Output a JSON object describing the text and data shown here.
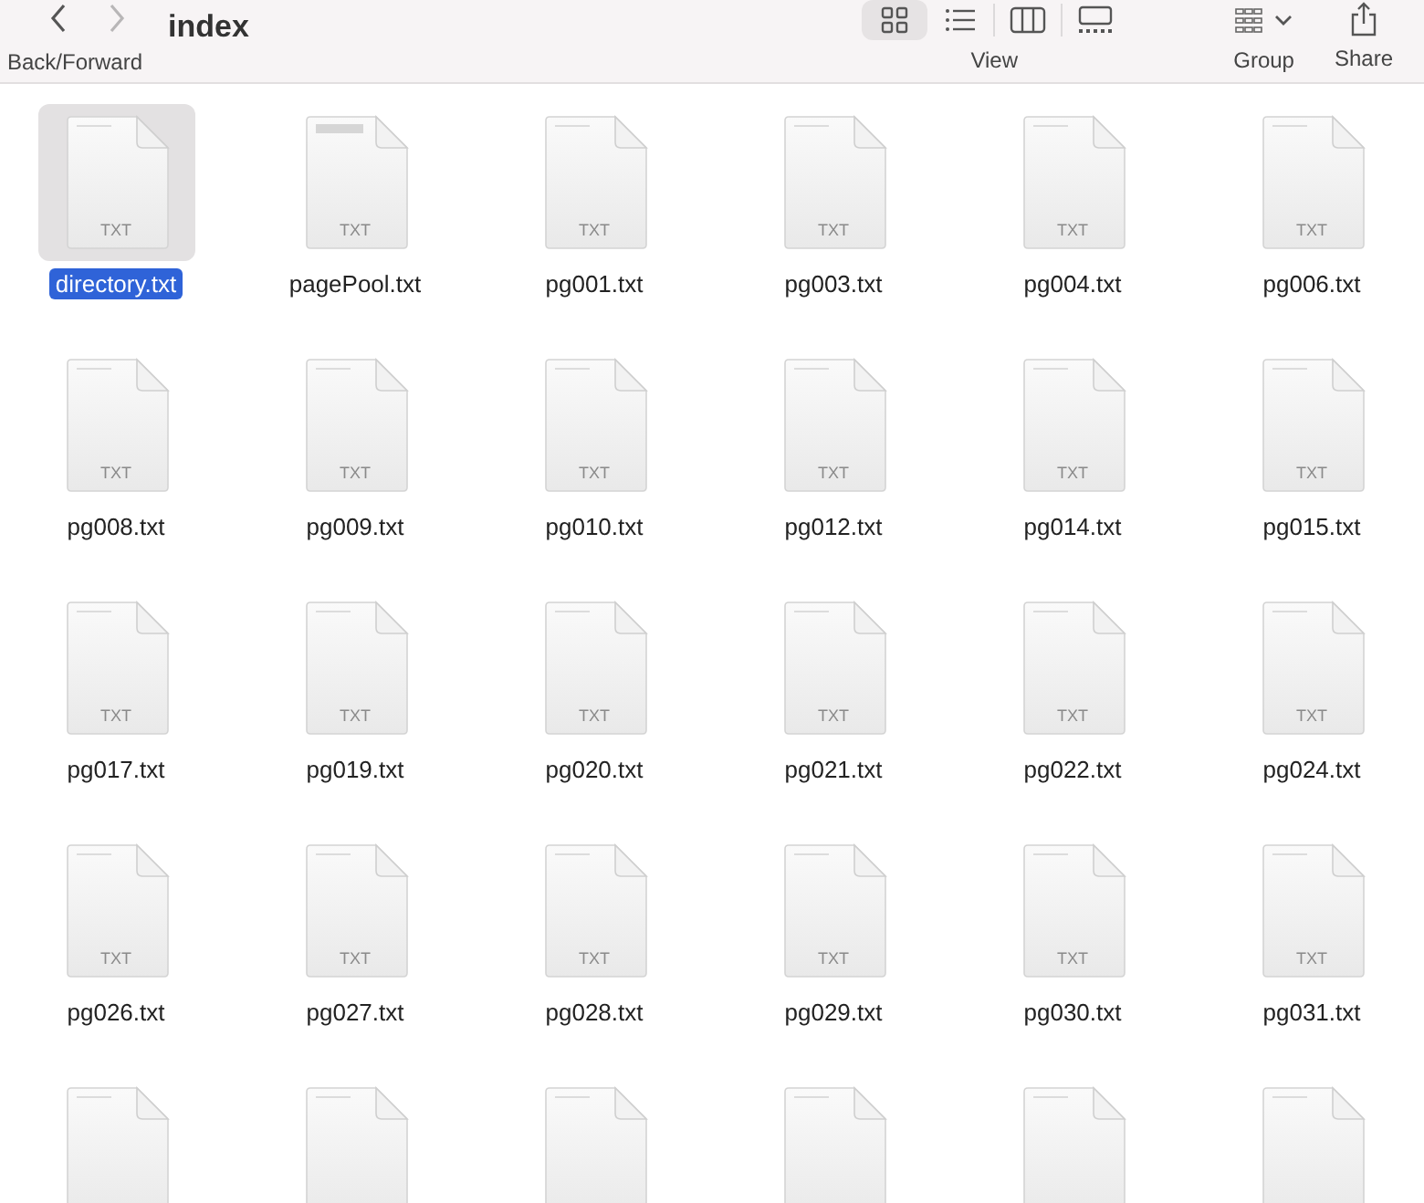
{
  "toolbar": {
    "nav_buttons": [
      {
        "kind": "back",
        "disabled": false
      },
      {
        "kind": "forward",
        "disabled": true
      }
    ],
    "nav_label": "Back/Forward",
    "title": "index",
    "view_modes": [
      {
        "kind": "icons",
        "selected": true
      },
      {
        "kind": "list",
        "selected": false
      },
      {
        "kind": "columns",
        "selected": false
      },
      {
        "kind": "gallery",
        "selected": false
      }
    ],
    "view_label": "View",
    "group_label": "Group",
    "share_label": "Share"
  },
  "files": [
    {
      "kind": "file",
      "name": "directory.txt",
      "badge": "TXT",
      "selected": true
    },
    {
      "kind": "file",
      "name": "pagePool.txt",
      "badge": "TXT",
      "selected": false
    },
    {
      "kind": "file",
      "name": "pg001.txt",
      "badge": "TXT",
      "selected": false
    },
    {
      "kind": "file",
      "name": "pg003.txt",
      "badge": "TXT",
      "selected": false
    },
    {
      "kind": "file",
      "name": "pg004.txt",
      "badge": "TXT",
      "selected": false
    },
    {
      "kind": "file",
      "name": "pg006.txt",
      "badge": "TXT",
      "selected": false
    },
    {
      "kind": "file",
      "name": "pg008.txt",
      "badge": "TXT",
      "selected": false
    },
    {
      "kind": "file",
      "name": "pg009.txt",
      "badge": "TXT",
      "selected": false
    },
    {
      "kind": "file",
      "name": "pg010.txt",
      "badge": "TXT",
      "selected": false
    },
    {
      "kind": "file",
      "name": "pg012.txt",
      "badge": "TXT",
      "selected": false
    },
    {
      "kind": "file",
      "name": "pg014.txt",
      "badge": "TXT",
      "selected": false
    },
    {
      "kind": "file",
      "name": "pg015.txt",
      "badge": "TXT",
      "selected": false
    },
    {
      "kind": "file",
      "name": "pg017.txt",
      "badge": "TXT",
      "selected": false
    },
    {
      "kind": "file",
      "name": "pg019.txt",
      "badge": "TXT",
      "selected": false
    },
    {
      "kind": "file",
      "name": "pg020.txt",
      "badge": "TXT",
      "selected": false
    },
    {
      "kind": "file",
      "name": "pg021.txt",
      "badge": "TXT",
      "selected": false
    },
    {
      "kind": "file",
      "name": "pg022.txt",
      "badge": "TXT",
      "selected": false
    },
    {
      "kind": "file",
      "name": "pg024.txt",
      "badge": "TXT",
      "selected": false
    },
    {
      "kind": "file",
      "name": "pg026.txt",
      "badge": "TXT",
      "selected": false
    },
    {
      "kind": "file",
      "name": "pg027.txt",
      "badge": "TXT",
      "selected": false
    },
    {
      "kind": "file",
      "name": "pg028.txt",
      "badge": "TXT",
      "selected": false
    },
    {
      "kind": "file",
      "name": "pg029.txt",
      "badge": "TXT",
      "selected": false
    },
    {
      "kind": "file",
      "name": "pg030.txt",
      "badge": "TXT",
      "selected": false
    },
    {
      "kind": "file",
      "name": "pg031.txt",
      "badge": "TXT",
      "selected": false
    },
    {
      "kind": "cut-off"
    },
    {
      "kind": "cut-off"
    },
    {
      "kind": "cut-off"
    },
    {
      "kind": "cut-off"
    },
    {
      "kind": "cut-off"
    },
    {
      "kind": "cut-off"
    }
  ]
}
